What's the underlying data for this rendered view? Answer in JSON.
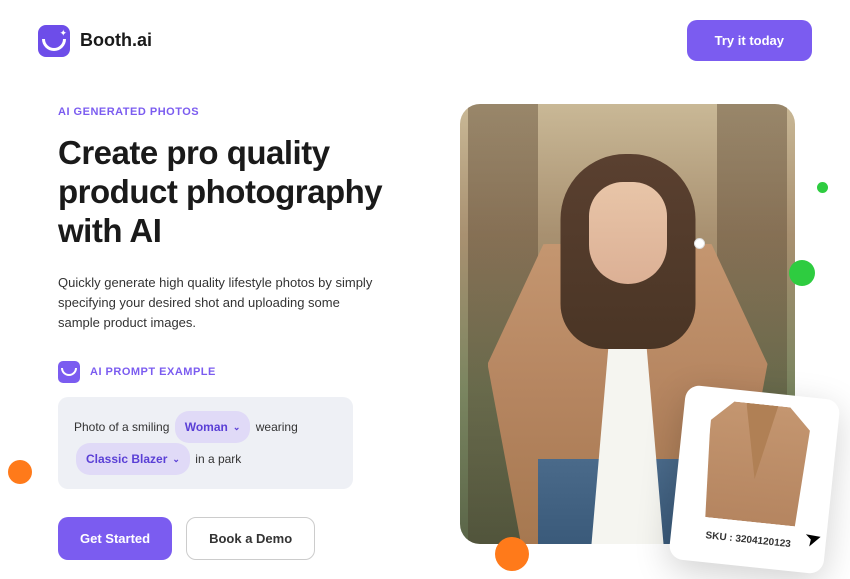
{
  "brand": "Booth.ai",
  "header": {
    "cta": "Try it today"
  },
  "hero": {
    "eyebrow": "AI GENERATED PHOTOS",
    "headline": "Create pro quality product photography with AI",
    "sub": "Quickly generate high quality lifestyle photos by simply specifying your desired shot and uploading some sample product images.",
    "prompt_label": "AI PROMPT EXAMPLE",
    "prompt": {
      "p1": "Photo of a smiling",
      "chip1": "Woman",
      "p2": "wearing",
      "chip2": "Classic Blazer",
      "p3": "in a park"
    },
    "actions": {
      "primary": "Get Started",
      "secondary": "Book a Demo"
    }
  },
  "card": {
    "sku": "SKU : 3204120123"
  }
}
